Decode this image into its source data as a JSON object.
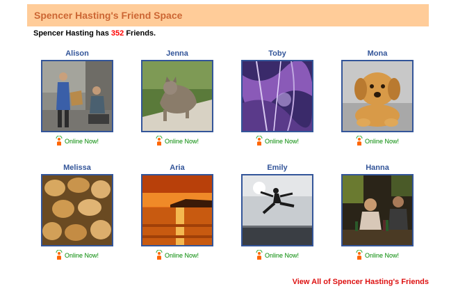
{
  "header": {
    "title": "Spencer Hasting's Friend Space"
  },
  "summary": {
    "prefix": "Spencer Hasting has",
    "count": "352",
    "suffix": "Friends."
  },
  "status_label": "Online Now!",
  "friends": [
    {
      "name": "Alison"
    },
    {
      "name": "Jenna"
    },
    {
      "name": "Toby"
    },
    {
      "name": "Mona"
    },
    {
      "name": "Melissa"
    },
    {
      "name": "Aria"
    },
    {
      "name": "Emily"
    },
    {
      "name": "Hanna"
    }
  ],
  "footer": {
    "view_all": "View All of Spencer Hasting's Friends"
  },
  "colors": {
    "header_bg": "#ffcc99",
    "header_text": "#cc6633",
    "name_text": "#335599",
    "count_text": "#ff0000",
    "online_text": "#008800",
    "link_text": "#dd1111"
  },
  "icons": {
    "online": "online-person-icon"
  }
}
